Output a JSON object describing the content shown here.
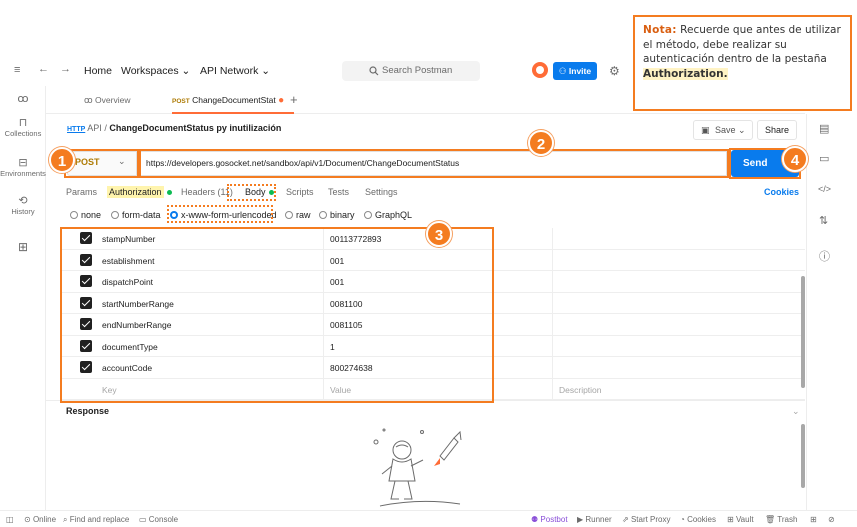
{
  "note": {
    "label": "Nota:",
    "text": "Recuerde que antes de utilizar el método, debe realizar su autenticación dentro de la pestaña",
    "emphasis": "Authorization."
  },
  "topnav": {
    "home": "Home",
    "workspaces": "Workspaces",
    "api_network": "API Network",
    "search_placeholder": "Search Postman",
    "invite": "Invite"
  },
  "sidebar": {
    "items": [
      {
        "label": "",
        "icon": "team-icon"
      },
      {
        "label": "Collections",
        "icon": "collections-icon"
      },
      {
        "label": "Environments",
        "icon": "environments-icon"
      },
      {
        "label": "History",
        "icon": "history-icon"
      },
      {
        "label": "",
        "icon": "add-apps-icon"
      }
    ]
  },
  "tabs": {
    "overview": "Overview",
    "request_method": "POST",
    "request_name": "ChangeDocumentStat"
  },
  "breadcrumb": {
    "root": "API",
    "separator": "/",
    "current": "ChangeDocumentStatus py inutilización"
  },
  "actions": {
    "save": "Save",
    "share": "Share",
    "send": "Send"
  },
  "request": {
    "method": "POST",
    "url": "https://developers.gosocket.net/sandbox/api/v1/Document/ChangeDocumentStatus"
  },
  "request_tabs": {
    "params": "Params",
    "authorization": "Authorization",
    "headers": "Headers (11)",
    "body": "Body",
    "scripts": "Scripts",
    "tests": "Tests",
    "settings": "Settings",
    "cookies": "Cookies"
  },
  "body_types": [
    "none",
    "form-data",
    "x-www-form-urlencoded",
    "raw",
    "binary",
    "GraphQL"
  ],
  "body_selected": "x-www-form-urlencoded",
  "params": [
    {
      "key": "stampNumber",
      "value": "00113772893",
      "checked": true
    },
    {
      "key": "establishment",
      "value": "001",
      "checked": true
    },
    {
      "key": "dispatchPoint",
      "value": "001",
      "checked": true
    },
    {
      "key": "startNumberRange",
      "value": "0081100",
      "checked": true
    },
    {
      "key": "endNumberRange",
      "value": "0081105",
      "checked": true
    },
    {
      "key": "documentType",
      "value": "1",
      "checked": true
    },
    {
      "key": "accountCode",
      "value": "800274638",
      "checked": true
    }
  ],
  "param_placeholders": {
    "key": "Key",
    "value": "Value",
    "description": "Description"
  },
  "response": {
    "title": "Response"
  },
  "statusbar": {
    "online": "Online",
    "find_replace": "Find and replace",
    "console": "Console",
    "postbot": "Postbot",
    "runner": "Runner",
    "start_proxy": "Start Proxy",
    "cookies": "Cookies",
    "vault": "Vault",
    "trash": "Trash"
  },
  "annotations": {
    "badge1": "1",
    "badge2": "2",
    "badge3": "3",
    "badge4": "4"
  },
  "colors": {
    "accent": "#f47c20",
    "primary": "#097bed",
    "method_post": "#ad7a03",
    "status_green": "#0cbb52"
  }
}
